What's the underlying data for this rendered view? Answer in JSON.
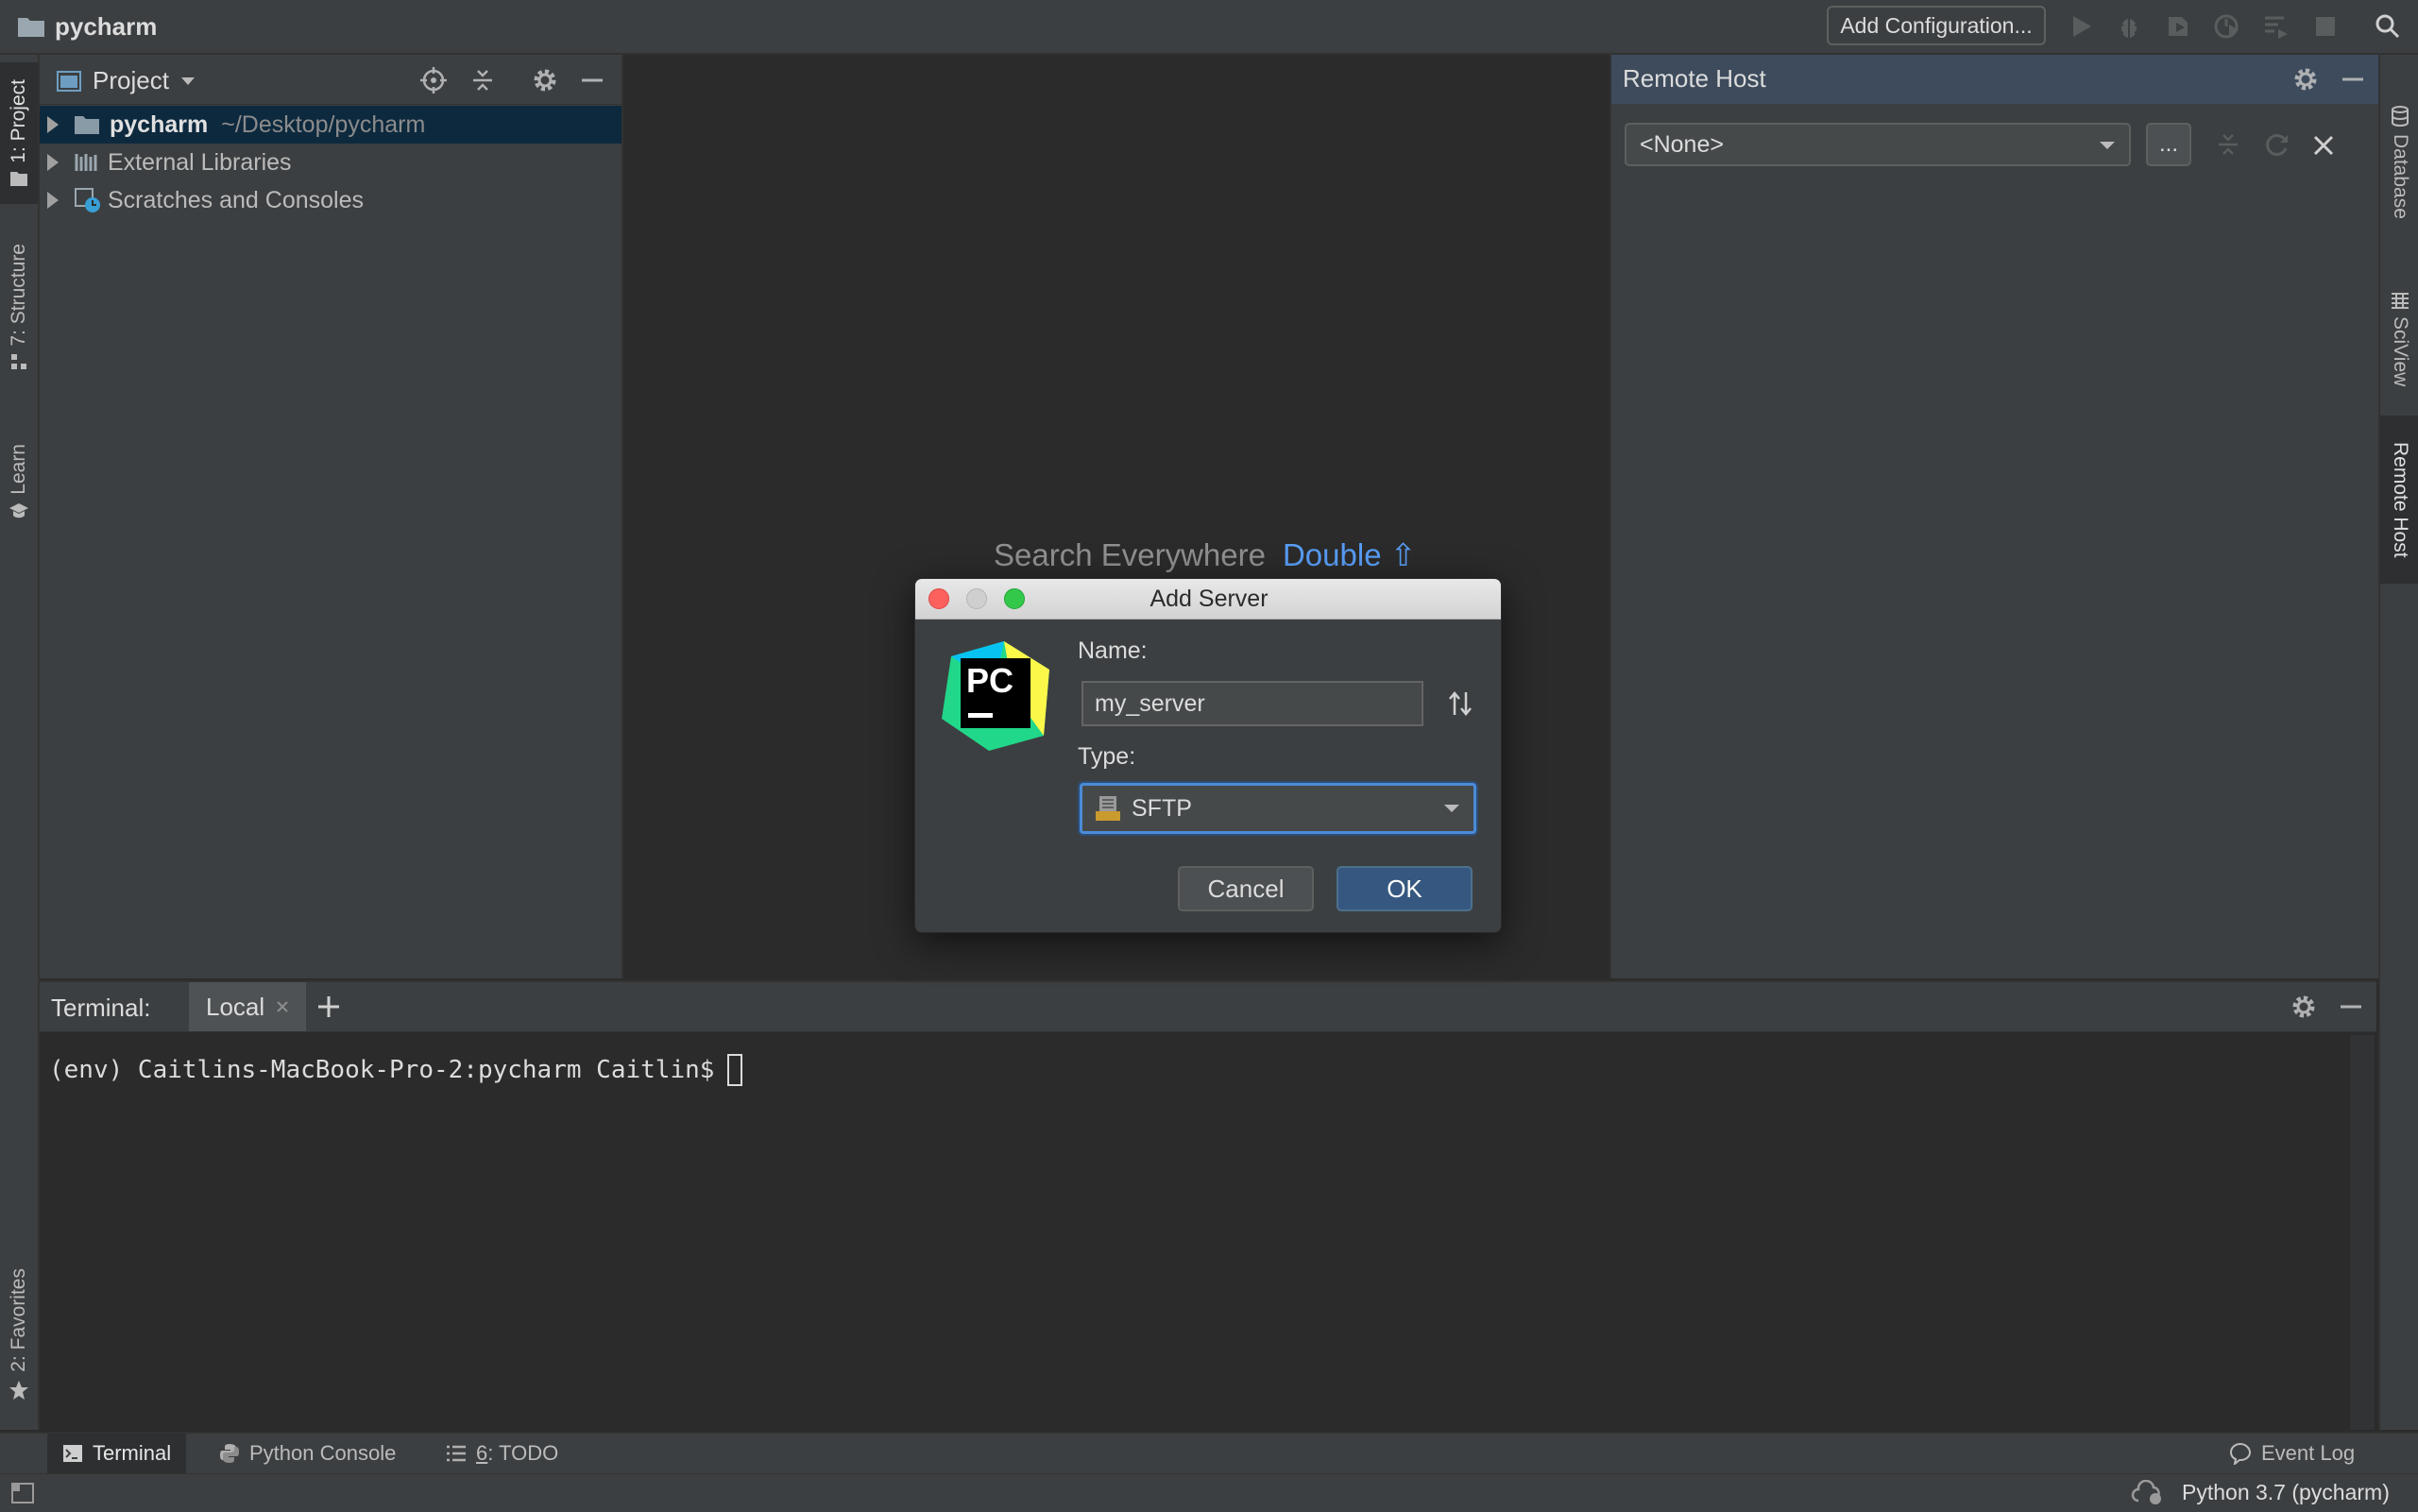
{
  "titlebar": {
    "project_name": "pycharm",
    "add_configuration": "Add Configuration..."
  },
  "left_tabs": {
    "project": "1: Project",
    "structure": "7: Structure",
    "learn": "Learn",
    "favorites": "2: Favorites"
  },
  "right_tabs": {
    "database": "Database",
    "sciview": "SciView",
    "remote_host": "Remote Host"
  },
  "project_panel": {
    "title": "Project",
    "tree": [
      {
        "label": "pycharm",
        "path": "~/Desktop/pycharm"
      },
      {
        "label": "External Libraries"
      },
      {
        "label": "Scratches and Consoles"
      }
    ]
  },
  "editor": {
    "search_hint": "Search Everywhere",
    "search_key": "Double ⇧"
  },
  "remote_host": {
    "title": "Remote Host",
    "server_select": "<None>",
    "more_button": "..."
  },
  "terminal": {
    "label": "Terminal:",
    "tab_local": "Local",
    "prompt": "(env) Caitlins-MacBook-Pro-2:pycharm Caitlin$"
  },
  "bottom_tabs": {
    "terminal": "Terminal",
    "python_console": "Python Console",
    "todo_prefix": "6",
    "todo": ": TODO",
    "event_log": "Event Log"
  },
  "statusbar": {
    "interpreter": "Python 3.7 (pycharm)"
  },
  "dialog": {
    "title": "Add Server",
    "name_label": "Name:",
    "name_value": "my_server",
    "type_label": "Type:",
    "type_value": "SFTP",
    "cancel": "Cancel",
    "ok": "OK",
    "logo_text": "PC"
  },
  "colors": {
    "accent_blue": "#589df6",
    "selection": "#0d293e",
    "ok_button": "#365880",
    "focus_ring": "#4b8bd7"
  }
}
